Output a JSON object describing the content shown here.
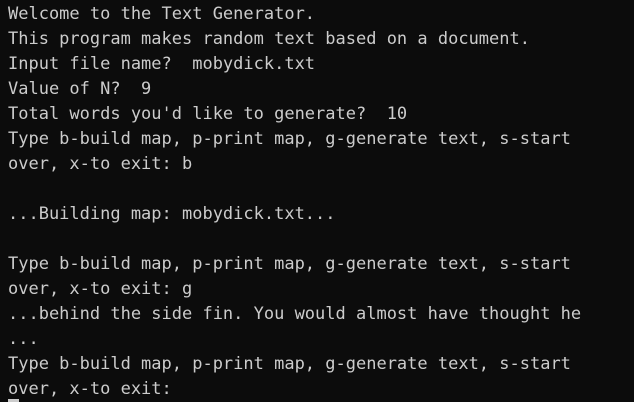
{
  "terminal": {
    "lines": [
      "Welcome to the Text Generator.",
      "This program makes random text based on a document.",
      "Input file name?  mobydick.txt",
      "Value of N?  9",
      "Total words you'd like to generate?  10",
      "Type b-build map, p-print map, g-generate text, s-start",
      "over, x-to exit: b",
      "",
      "...Building map: mobydick.txt...",
      "",
      "Type b-build map, p-print map, g-generate text, s-start",
      "over, x-to exit: g",
      "...behind the side fin. You would almost have thought he",
      "...",
      "Type b-build map, p-print map, g-generate text, s-start",
      "over, x-to exit: "
    ]
  },
  "colors": {
    "background": "#0c0c0c",
    "foreground": "#cccccc"
  }
}
